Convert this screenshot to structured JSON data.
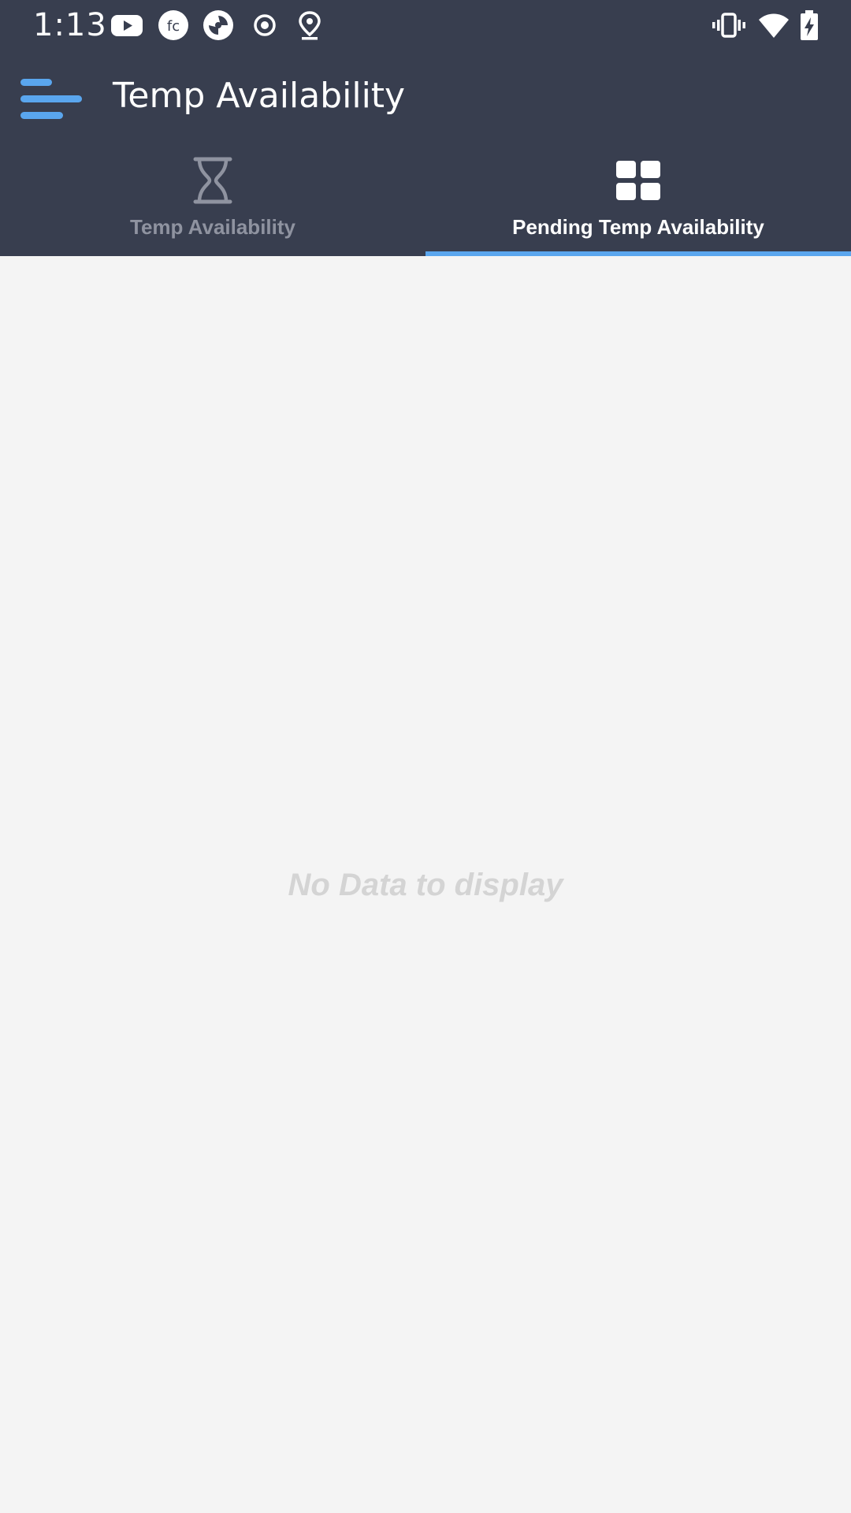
{
  "status_bar": {
    "time": "1:13",
    "icons": [
      "youtube-icon",
      "fc-app-icon",
      "aperture-app-icon",
      "record-icon",
      "location-icon",
      "vibrate-icon",
      "wifi-icon",
      "battery-charging-icon"
    ]
  },
  "app_bar": {
    "menu_icon": "menu-icon",
    "title": "Temp Availability"
  },
  "tabs": [
    {
      "label": "Temp Availability",
      "icon": "hourglass-icon",
      "selected": false
    },
    {
      "label": "Pending Temp Availability",
      "icon": "grid-icon",
      "selected": true
    }
  ],
  "content": {
    "empty_message": "No Data to display"
  },
  "colors": {
    "header_bg": "#383e4f",
    "accent": "#5aa6ee",
    "page_bg": "#f4f4f4",
    "inactive_tab": "#8f93a0",
    "empty_text": "#d4d4d4"
  }
}
